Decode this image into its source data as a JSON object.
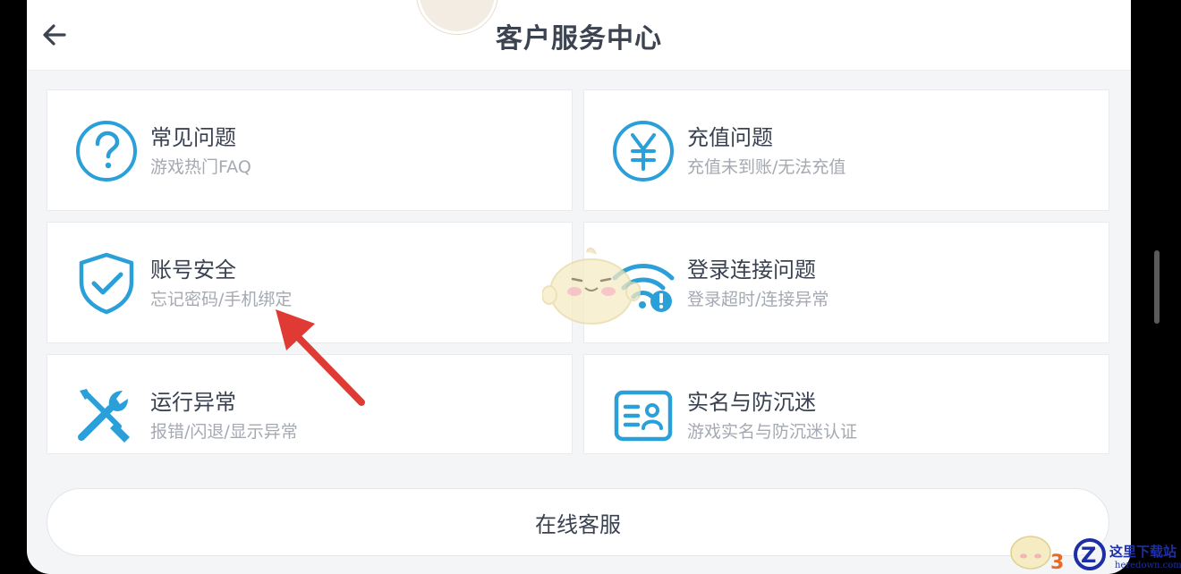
{
  "header": {
    "title": "客户服务中心",
    "back_icon": "arrow-left-icon"
  },
  "cards": [
    {
      "title": "常见问题",
      "subtitle": "游戏热门FAQ",
      "icon": "question-circle-icon"
    },
    {
      "title": "充值问题",
      "subtitle": "充值未到账/无法充值",
      "icon": "yen-circle-icon"
    },
    {
      "title": "账号安全",
      "subtitle": "忘记密码/手机绑定",
      "icon": "shield-check-icon"
    },
    {
      "title": "登录连接问题",
      "subtitle": "登录超时/连接异常",
      "icon": "wifi-alert-icon"
    },
    {
      "title": "运行异常",
      "subtitle": "报错/闪退/显示异常",
      "icon": "wrench-screwdriver-icon"
    },
    {
      "title": "实名与防沉迷",
      "subtitle": "游戏实名与防沉迷认证",
      "icon": "id-card-icon"
    }
  ],
  "online_service": {
    "label": "在线客服"
  },
  "watermark": {
    "text": "这里下载站",
    "url": "heredown.com"
  },
  "colors": {
    "accent": "#2a9fd8",
    "title": "#3c4452",
    "subtitle": "#a4a9b2",
    "annotation": "#e03a35"
  }
}
